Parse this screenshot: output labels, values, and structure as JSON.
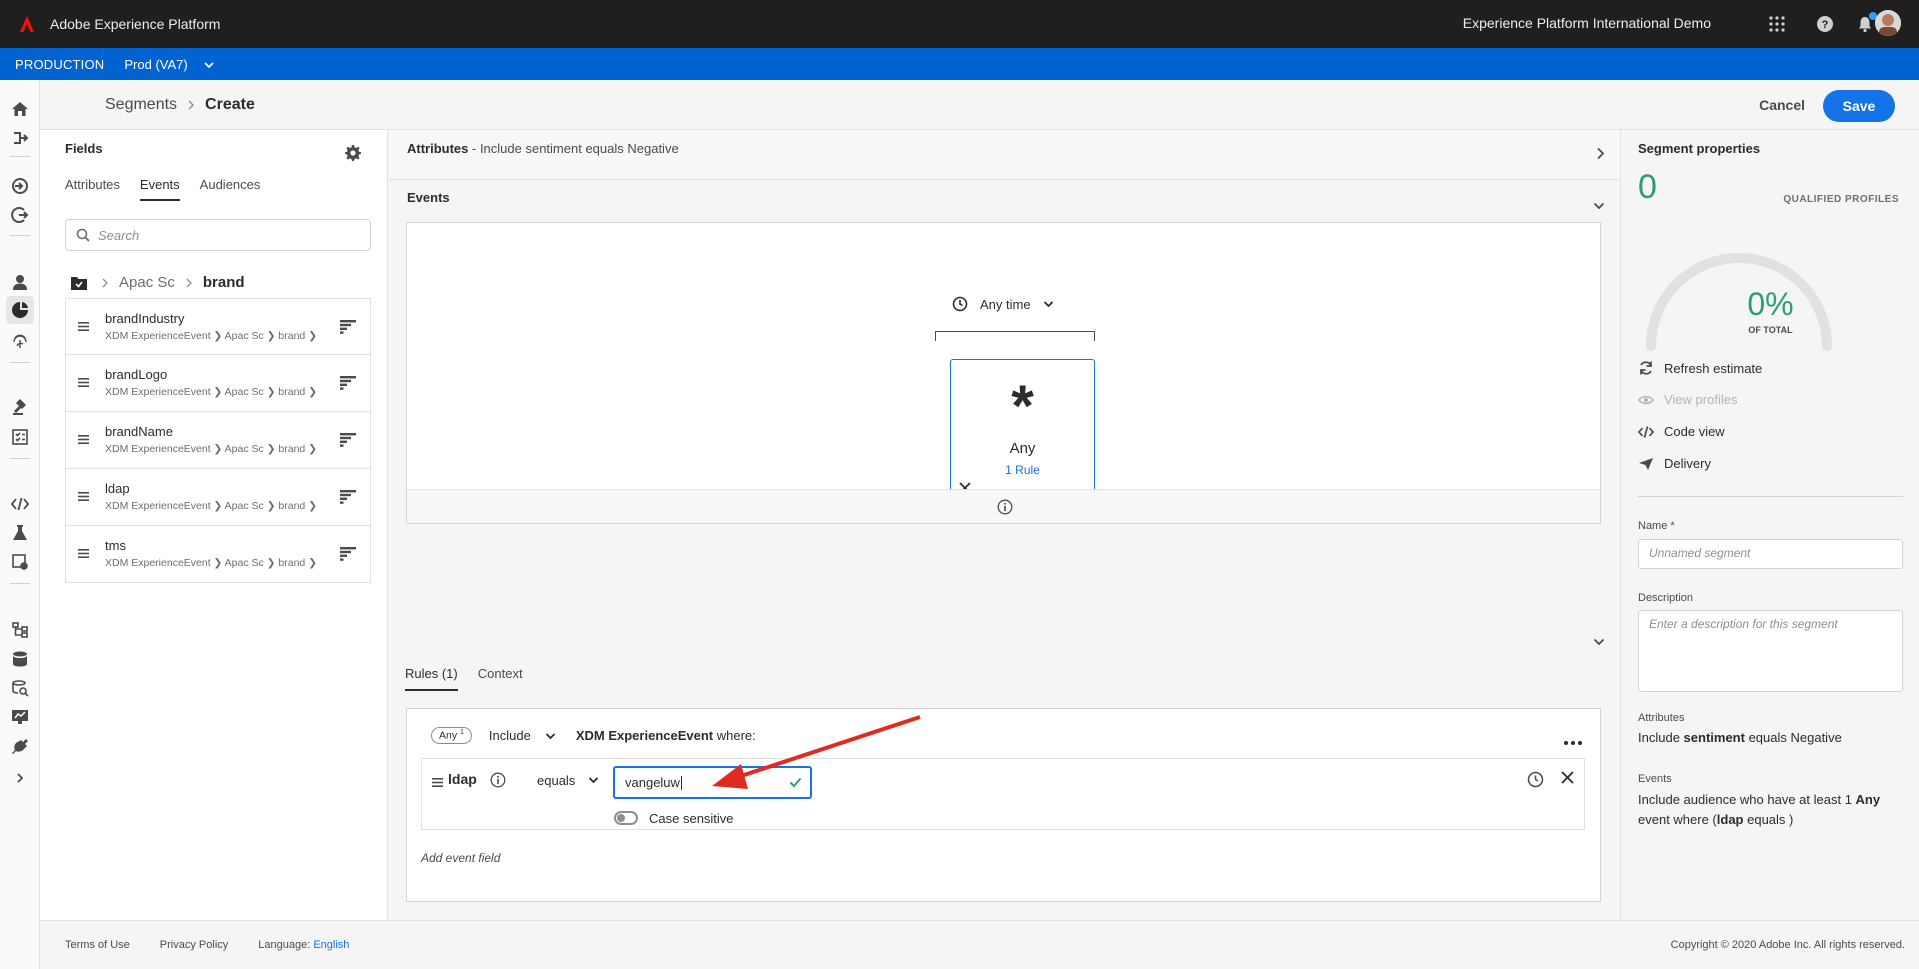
{
  "app": {
    "title": "Adobe Experience Platform",
    "org": "Experience Platform International Demo"
  },
  "sandbox": {
    "env": "PRODUCTION",
    "name": "Prod (VA7)"
  },
  "breadcrumb": {
    "parent": "Segments",
    "current": "Create"
  },
  "header": {
    "cancel": "Cancel",
    "save": "Save"
  },
  "fields": {
    "title": "Fields",
    "tabs": [
      "Attributes",
      "Events",
      "Audiences"
    ],
    "search_placeholder": "Search",
    "path": {
      "parent": "Apac Sc",
      "current": "brand"
    },
    "items": [
      {
        "name": "brandIndustry",
        "path": "XDM ExperienceEvent ❯ Apac Sc ❯ brand ❯"
      },
      {
        "name": "brandLogo",
        "path": "XDM ExperienceEvent ❯ Apac Sc ❯ brand ❯"
      },
      {
        "name": "brandName",
        "path": "XDM ExperienceEvent ❯ Apac Sc ❯ brand ❯"
      },
      {
        "name": "ldap",
        "path": "XDM ExperienceEvent ❯ Apac Sc ❯ brand ❯"
      },
      {
        "name": "tms",
        "path": "XDM ExperienceEvent ❯ Apac Sc ❯ brand ❯"
      }
    ]
  },
  "canvas": {
    "attr_label": "Attributes",
    "attr_text": " - Include sentiment equals Negative",
    "events_label": "Events",
    "anytime": "Any time",
    "card_label": "Any",
    "card_rule": "1 Rule",
    "rule_tabs": [
      "Rules (1)",
      "Context"
    ],
    "rule": {
      "pill": "Any",
      "pill_sup": "1",
      "include": "Include",
      "entity": "XDM ExperienceEvent",
      "where": " where:",
      "field": "ldap",
      "operator": "equals",
      "value": "vangeluw",
      "case_label": "Case sensitive",
      "add_field": "Add event field"
    }
  },
  "props": {
    "title": "Segment properties",
    "count": "0",
    "qualified": "QUALIFIED PROFILES",
    "pct": "0%",
    "of_total": "OF TOTAL",
    "actions": {
      "refresh": "Refresh estimate",
      "view": "View profiles",
      "code": "Code view",
      "delivery": "Delivery"
    },
    "name_label": "Name *",
    "name_placeholder": "Unnamed segment",
    "desc_label": "Description",
    "desc_placeholder": "Enter a description for this segment",
    "attributes_label": "Attributes",
    "attributes_pre": "Include ",
    "attributes_field": "sentiment",
    "attributes_post": " equals Negative",
    "events_label": "Events",
    "events_pre": "Include audience who have at least 1 ",
    "events_any": "Any",
    "events_mid": " event where (",
    "events_field": "ldap",
    "events_post": " equals )"
  },
  "footer": {
    "terms": "Terms of Use",
    "privacy": "Privacy Policy",
    "language_label": "Language: ",
    "language": "English",
    "copyright": "Copyright ©  2020 Adobe Inc.  All rights reserved."
  },
  "colors": {
    "accent": "#1473e6",
    "sandbox": "#0063d1",
    "success": "#2d9d78",
    "annotation": "#e02b20"
  }
}
